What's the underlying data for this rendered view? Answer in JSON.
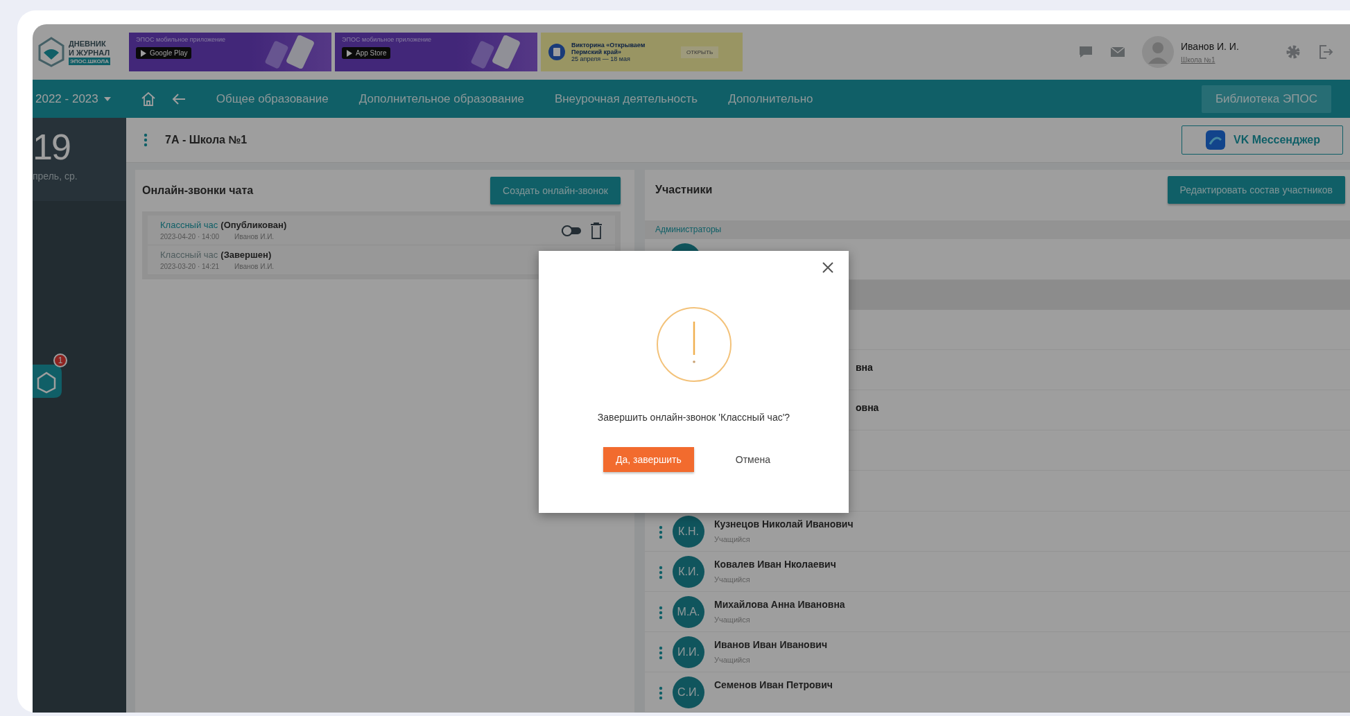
{
  "header": {
    "logo": {
      "line_1": "ДНЕВНИК",
      "line_2": "И ЖУРНАЛ",
      "line_3": "ЭПОС.ШКОЛА"
    },
    "banners": [
      {
        "kind": "app",
        "title": "ЭПОС мобильное приложение",
        "store": "Google Play"
      },
      {
        "kind": "app",
        "title": "ЭПОС мобильное приложение",
        "store": "App Store"
      },
      {
        "kind": "quiz",
        "title": "Викторина «Открываем Пермский край»",
        "dates": "25 апреля — 18 мая",
        "button": "ОТКРЫТЬ"
      }
    ],
    "user": {
      "name": "Иванов И. И.",
      "school": "Школа №1"
    }
  },
  "nav": {
    "year": "2022 - 2023",
    "items": [
      "Общее образование",
      "Дополнительное образование",
      "Внеурочная деятельность",
      "Дополнительно"
    ],
    "library_button": "Библиотека ЭПОС"
  },
  "sidebar": {
    "day": "19",
    "date": "прель, ср.",
    "notification_count": "1"
  },
  "class_bar": {
    "title": "7А - Школа №1",
    "messenger_button": "VK Мессенджер"
  },
  "calls": {
    "title": "Онлайн-звонки чата",
    "create_button": "Создать онлайн-звонок",
    "items": [
      {
        "kind": "published",
        "toggle_on": false,
        "name": "Классный час",
        "status": "(Опубликован)",
        "date": "2023-04-20 · 14:00",
        "author": "Иванов И.И."
      },
      {
        "kind": "finished",
        "name": "Классный час",
        "status": "(Завершен)",
        "date": "2023-03-20 · 14:21",
        "author": "Иванов И.И."
      }
    ]
  },
  "members": {
    "title": "Участники",
    "edit_button": "Редактировать состав участников",
    "admin_group": "Администраторы",
    "covered_rows": [
      {
        "name_tail": "вна"
      },
      {
        "name_tail": "овна"
      }
    ],
    "students": [
      {
        "initials": "К.Н.",
        "name": "Кузнецов Николай Иванович",
        "role": "Учащийся"
      },
      {
        "initials": "К.И.",
        "name": "Ковалев Иван Нколаевич",
        "role": "Учащийся"
      },
      {
        "initials": "М.А.",
        "name": "Михайлова Анна Ивановна",
        "role": "Учащийся"
      },
      {
        "initials": "И.И.",
        "name": "Иванов Иван Иванович",
        "role": "Учащийся"
      },
      {
        "initials": "С.И.",
        "name": "Семенов Иван Петрович"
      }
    ]
  },
  "dialog": {
    "message": "Завершить онлайн-звонок 'Классный час'?",
    "confirm_button": "Да, завершить",
    "cancel_button": "Отмена"
  }
}
